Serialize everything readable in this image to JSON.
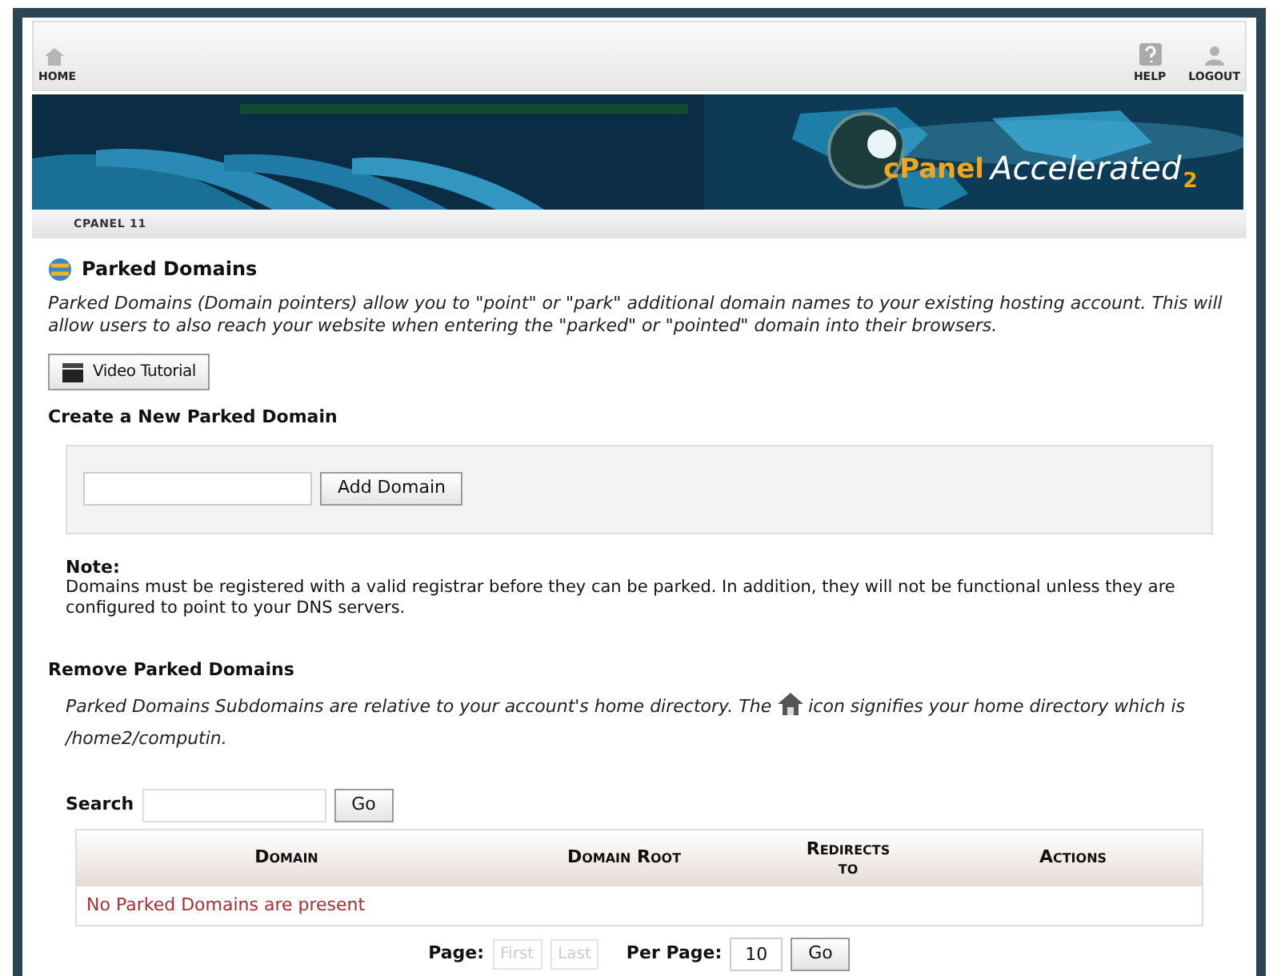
{
  "top_nav": {
    "home": "HOME",
    "help": "HELP",
    "logout": "LOGOUT"
  },
  "banner": {
    "brand": "cPanel",
    "product": "Accelerated",
    "version": "2"
  },
  "breadcrumb": "CPANEL 11",
  "page": {
    "title": "Parked Domains",
    "description": "Parked Domains (Domain pointers) allow you to \"point\" or \"park\" additional domain names to your existing hosting account. This will allow users to also reach your website when entering the \"parked\" or \"pointed\" domain into their browsers.",
    "video_button": "Video Tutorial"
  },
  "create": {
    "heading": "Create a New Parked Domain",
    "button": "Add Domain",
    "note_label": "Note:",
    "note": "Domains must be registered with a valid registrar before they can be parked. In addition, they will not be functional unless they are configured to point to your DNS servers."
  },
  "remove": {
    "heading": "Remove Parked Domains",
    "description_before": "Parked Domains Subdomains are relative to your account's home directory. The",
    "description_after": "icon signifies your home directory which is /home2/computin.",
    "search_label": "Search",
    "search_button": "Go"
  },
  "table": {
    "columns": [
      "Domain",
      "Domain Root",
      "Redirects to",
      "Actions"
    ],
    "empty_message": "No Parked Domains are present"
  },
  "paging": {
    "page_label": "Page:",
    "buttons": [
      {
        "label": "First",
        "disabled": true
      },
      {
        "label": "Last",
        "disabled": true
      }
    ],
    "per_page_label": "Per Page:",
    "per_page": "10",
    "go": "Go"
  }
}
